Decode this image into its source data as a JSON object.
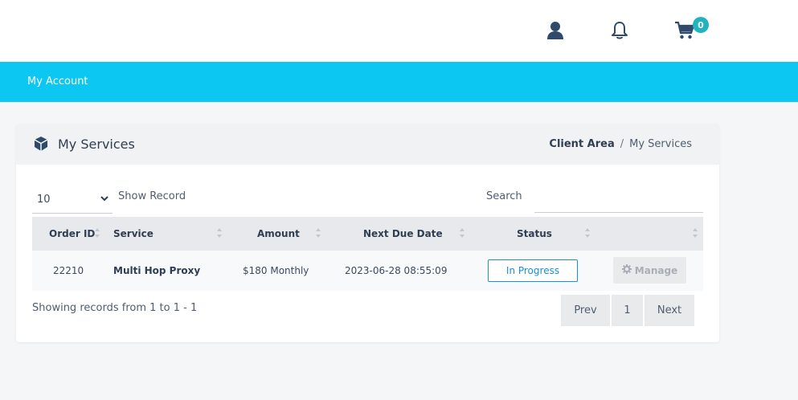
{
  "header": {
    "icons": [
      "user-icon",
      "bell-icon",
      "cart-icon"
    ],
    "cart_count": "0"
  },
  "nav": {
    "my_account": "My Account"
  },
  "card": {
    "title": "My Services",
    "title_icon": "box-icon",
    "breadcrumb": {
      "root": "Client Area",
      "separator": "/",
      "current": "My Services"
    }
  },
  "controls": {
    "length_value": "10",
    "show_record_label": "Show Record",
    "search_label": "Search",
    "search_value": ""
  },
  "table": {
    "columns": [
      "Order ID",
      "Service",
      "Amount",
      "Next Due Date",
      "Status",
      ""
    ],
    "rows": [
      {
        "order_id": "22210",
        "service": "Multi Hop Proxy",
        "amount": "$180 Monthly",
        "next_due_date": "2023-06-28 08:55:09",
        "status": "In Progress",
        "action": "Manage"
      }
    ]
  },
  "footer": {
    "info": "Showing records from 1 to 1 - 1",
    "prev": "Prev",
    "page": "1",
    "next": "Next"
  },
  "colors": {
    "accent_bar": "#0bc7f1",
    "badge": "#21b3c0",
    "status_border": "#1a8fd6"
  }
}
